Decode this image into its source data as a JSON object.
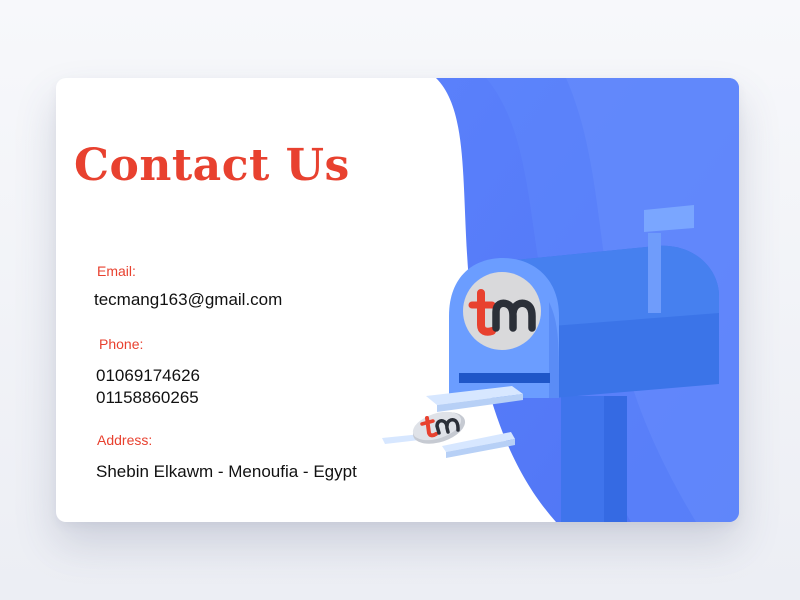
{
  "contact": {
    "title": "Contact Us",
    "email_label": "Email:",
    "email": "tecmang163@gmail.com",
    "phone_label": "Phone:",
    "phones": [
      "01069174626",
      "01158860265"
    ],
    "address_label": "Address:",
    "address": "Shebin Elkawm - Menoufia - Egypt"
  },
  "logo": {
    "text": "tm"
  },
  "colors": {
    "accent_red": "#e8412f",
    "panel_blue": "#5b82fb",
    "mailbox_blue": "#3a72e8",
    "text_dark": "#111111",
    "card_bg": "#ffffff"
  },
  "icons": {
    "illustration": "mailbox-illustration",
    "brand": "tm-logo-icon"
  }
}
